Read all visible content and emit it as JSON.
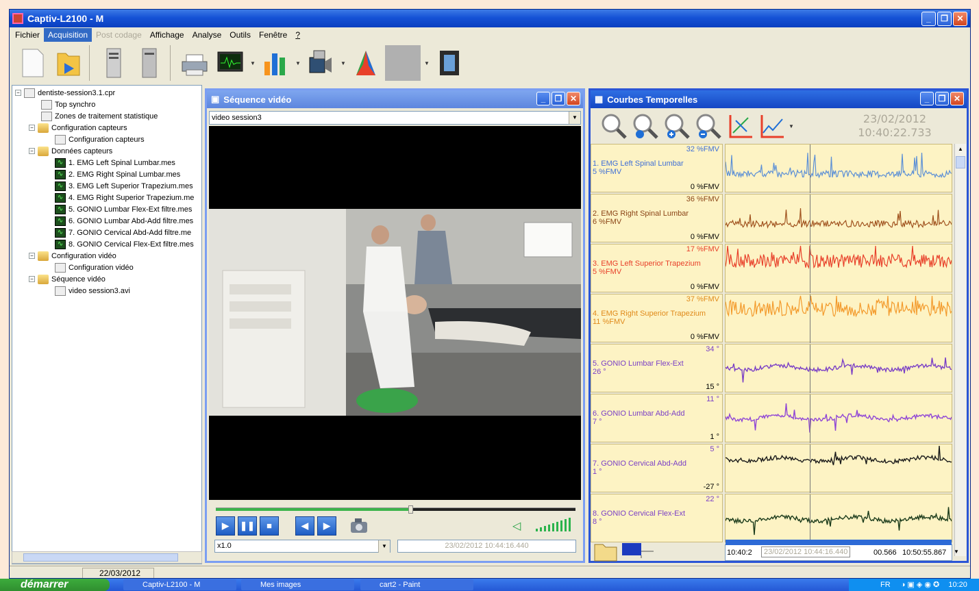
{
  "window": {
    "title": "Captiv-L2100 - M"
  },
  "menu": [
    "Fichier",
    "Acquisition",
    "Post codage",
    "Affichage",
    "Analyse",
    "Outils",
    "Fenêtre",
    "?"
  ],
  "tree": {
    "root": "dentiste-session3.1.cpr",
    "items": [
      "Top synchro",
      "Zones de traitement statistique",
      "Configuration capteurs",
      "Configuration capteurs",
      "Données capteurs",
      "1. EMG Left Spinal Lumbar.mes",
      "2. EMG Right Spinal Lumbar.mes",
      "3. EMG Left Superior Trapezium.mes",
      "4. EMG Right Superior Trapezium.me",
      "5. GONIO Lumbar Flex-Ext filtre.mes",
      "6. GONIO Lumbar Abd-Add filtre.mes",
      "7. GONIO Cervical Abd-Add filtre.me",
      "8. GONIO Cervical Flex-Ext filtre.mes",
      "Configuration vidéo",
      "Configuration vidéo",
      "Séquence vidéo",
      "video session3.avi"
    ]
  },
  "status": {
    "date": "22/03/2012"
  },
  "video_window": {
    "title": "Séquence vidéo",
    "source": "video session3",
    "speed": "x1.0",
    "timestamp": "23/02/2012 10:44:16.440",
    "progress": 0.54
  },
  "curves_window": {
    "title": "Courbes Temporelles",
    "date": "23/02/2012",
    "time": "10:40:22.733",
    "rows": [
      {
        "name": "1. EMG Left Spinal Lumbar",
        "value": "5 %FMV",
        "max": "32 %FMV",
        "min": "0 %FMV",
        "color": "#5b8fd6",
        "name_color": "#3f6fd6"
      },
      {
        "name": "2. EMG Right Spinal Lumbar",
        "value": "6 %FMV",
        "max": "36 %FMV",
        "min": "0 %FMV",
        "color": "#a0521e",
        "name_color": "#8a4416"
      },
      {
        "name": "3. EMG Left Superior Trapezium",
        "value": "5 %FMV",
        "max": "17 %FMV",
        "min": "0 %FMV",
        "color": "#e8402a",
        "name_color": "#e8402a"
      },
      {
        "name": "4. EMG Right Superior Trapezium",
        "value": "11 %FMV",
        "max": "37 %FMV",
        "min": "0 %FMV",
        "color": "#f39a2b",
        "name_color": "#e08a1a"
      },
      {
        "name": "5. GONIO Lumbar Flex-Ext",
        "value": "26 °",
        "max": "34 °",
        "min": "15 °",
        "color": "#7a3fc6",
        "name_color": "#7a3fc6"
      },
      {
        "name": "6. GONIO Lumbar Abd-Add",
        "value": "7 °",
        "max": "11 °",
        "min": "1 °",
        "color": "#8f45d6",
        "name_color": "#7a3fc6"
      },
      {
        "name": "7. GONIO Cervical Abd-Add",
        "value": "1 °",
        "max": "5 °",
        "min": "-27 °",
        "color": "#1a1a1a",
        "name_color": "#7a3fc6"
      },
      {
        "name": "8. GONIO Cervical Flex-Ext",
        "value": "8 °",
        "max": "22 °",
        "min": "",
        "color": "#1a3a1a",
        "name_color": "#7a3fc6"
      }
    ],
    "timeline": {
      "start": "10:40:2",
      "cursor": "23/02/2012 10:44:16.440",
      "mid": "00.566",
      "end": "10:50:55.867"
    }
  },
  "taskbar": {
    "start": "démarrer",
    "tasks": [
      "Captiv-L2100 - M",
      "Mes images",
      "cart2 - Paint"
    ],
    "lang": "FR",
    "clock": "10:20"
  }
}
